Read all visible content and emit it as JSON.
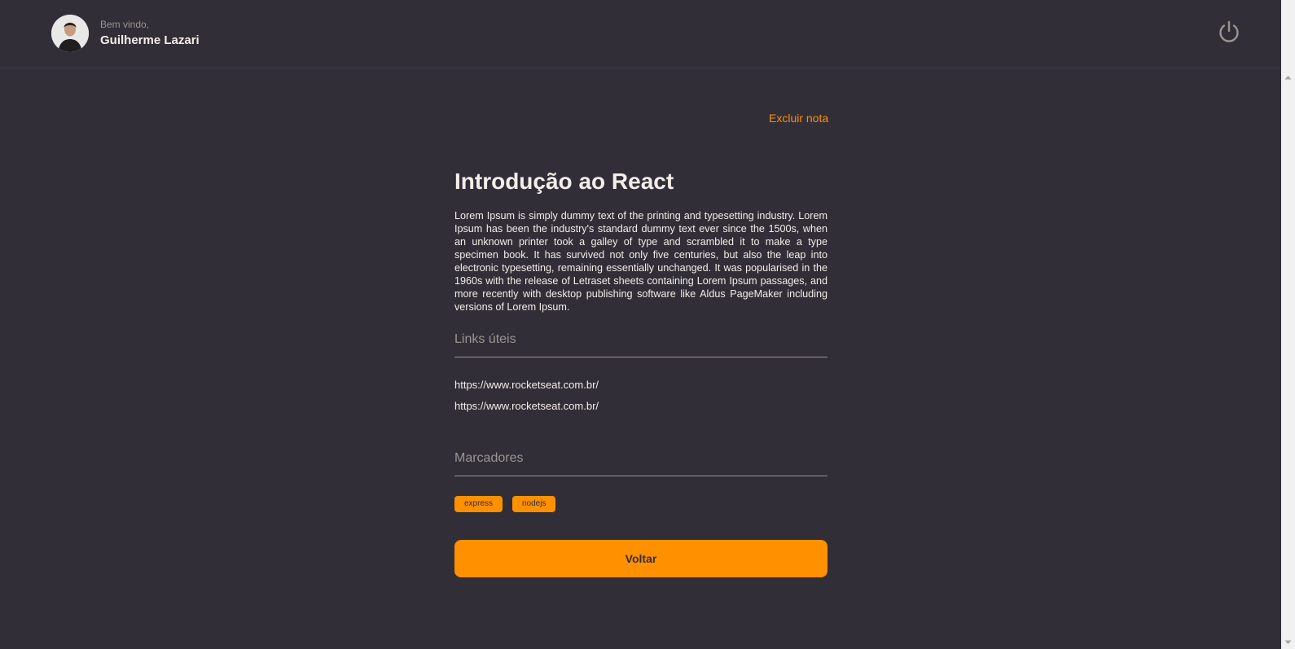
{
  "header": {
    "welcome": "Bem vindo,",
    "username": "Guilherme Lazari",
    "logout_icon": "power-icon"
  },
  "note": {
    "delete_label": "Excluir nota",
    "title": "Introdução ao React",
    "description": "Lorem Ipsum is simply dummy text of the printing and typesetting industry. Lorem Ipsum has been the industry's standard dummy text ever since the 1500s, when an unknown printer took a galley of type and scrambled it to make a type specimen book. It has survived not only five centuries, but also the leap into electronic typesetting, remaining essentially unchanged. It was popularised in the 1960s with the release of Letraset sheets containing Lorem Ipsum passages, and more recently with desktop publishing software like Aldus PageMaker including versions of Lorem Ipsum.",
    "links_title": "Links úteis",
    "links": [
      "https://www.rocketseat.com.br/",
      "https://www.rocketseat.com.br/"
    ],
    "tags_title": "Marcadores",
    "tags": [
      "express",
      "nodejs"
    ],
    "back_label": "Voltar"
  },
  "colors": {
    "background": "#312e38",
    "accent": "#ff9000",
    "text": "#f4ede8",
    "muted": "#999591"
  }
}
